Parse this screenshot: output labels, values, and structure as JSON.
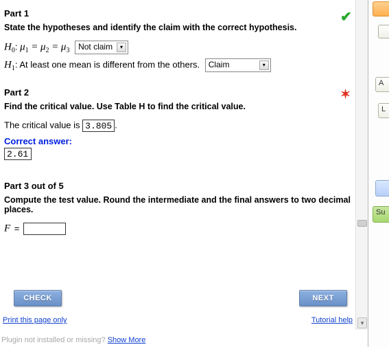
{
  "part1": {
    "title": "Part 1",
    "instr": "State the hypotheses and identify the claim with the correct hypothesis.",
    "h0_prefix_H": "H",
    "h0_sub0": "0",
    "h0_colon": ":",
    "mu": "μ",
    "sub1": "1",
    "eq": "=",
    "sub2": "2",
    "sub3": "3",
    "h0_select": "Not claim",
    "h1_prefix_H": "H",
    "h1_sub1": "1",
    "h1_text": ": At least one mean is different from the others.",
    "h1_select": "Claim"
  },
  "part2": {
    "title": "Part 2",
    "instr": "Find the critical value. Use Table H to find the critical value.",
    "crit_label": "The critical value is ",
    "crit_entered": "3.805",
    "period": ".",
    "correct_label": "Correct answer:",
    "correct_value": "2.61"
  },
  "part3": {
    "title": "Part 3 out of 5",
    "instr": "Compute the test value. Round the intermediate and the final answers to two decimal places.",
    "F": "F",
    "eq": "=",
    "value": ""
  },
  "buttons": {
    "check": "CHECK",
    "next": "NEXT"
  },
  "links": {
    "print": "Print this page only",
    "tutorial": "Tutorial help",
    "plugin_pre": "Plugin not installed or missing? ",
    "plugin_link": "Show More"
  },
  "rail": {
    "A": "A",
    "L": "L",
    "Su": "Su"
  }
}
